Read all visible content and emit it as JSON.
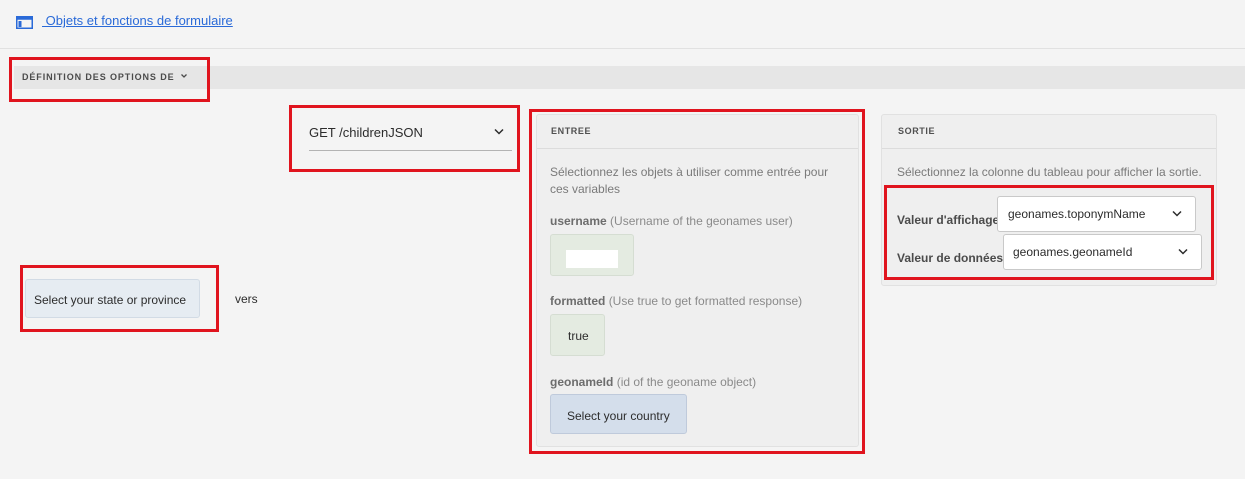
{
  "header": {
    "link_label": " Objets et fonctions de formulaire",
    "icon": "form-objects-icon"
  },
  "section": {
    "title": "DÉFINITION DES OPTIONS DE",
    "chevron_icon": "chevron-down-icon"
  },
  "target": {
    "field_label": "Select your state or province",
    "connector": "vers"
  },
  "service": {
    "selected": "GET /childrenJSON",
    "chevron_icon": "chevron-down-icon"
  },
  "input_panel": {
    "title": "ENTREE",
    "help": "Sélectionnez les objets à utiliser comme entrée pour ces variables",
    "params": [
      {
        "name": "username",
        "description": "(Username of the geonames user)",
        "value": ""
      },
      {
        "name": "formatted",
        "description": "(Use true to get formatted response)",
        "value": "true"
      },
      {
        "name": "geonameId",
        "description": "(id of the geoname object)",
        "value": "Select your country"
      }
    ]
  },
  "output_panel": {
    "title": "SORTIE",
    "help": "Sélectionnez la colonne du tableau pour afficher la sortie.",
    "display": {
      "label": "Valeur d'affichage",
      "selected": "geonames.toponymName"
    },
    "data": {
      "label": "Valeur de données",
      "selected": "geonames.geonameId"
    }
  },
  "colors": {
    "highlight": "#e0141e",
    "link": "#2a6ad8"
  }
}
